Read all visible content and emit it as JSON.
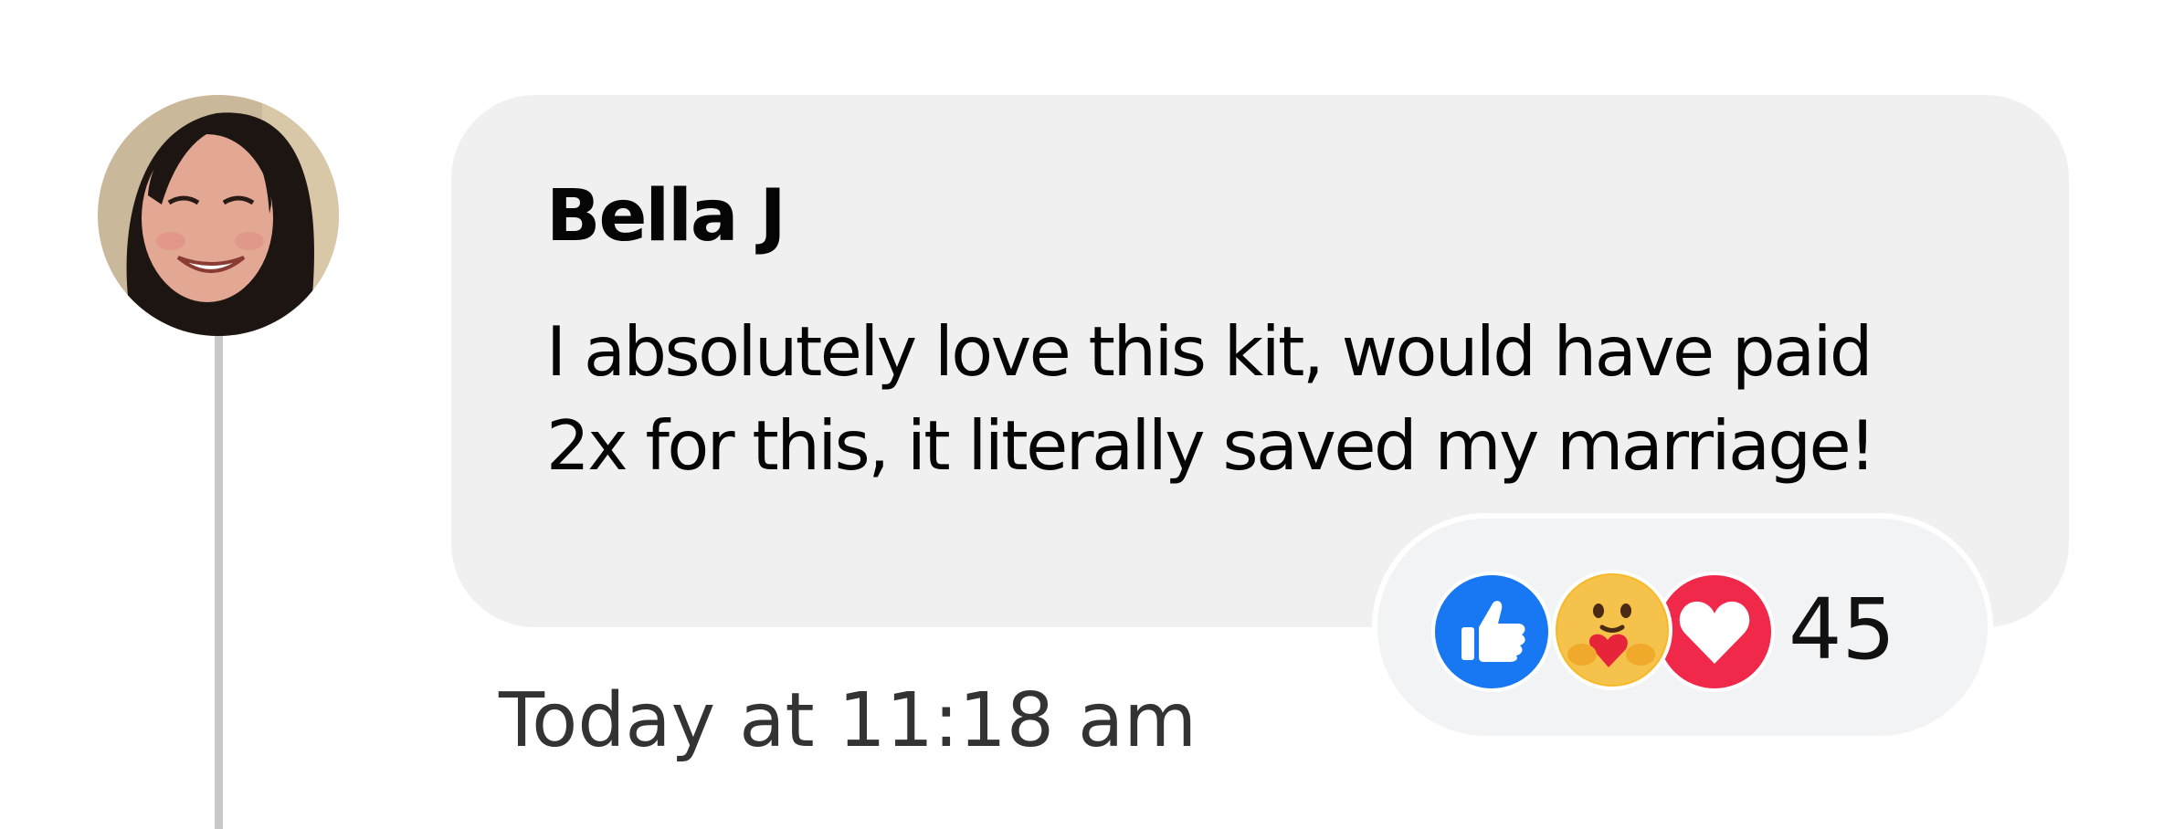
{
  "comment": {
    "author": "Bella J",
    "text_lines": [
      "I absolutely love this kit, would have paid",
      "2x for this, it literally saved my marriage!"
    ],
    "timestamp": "Today at 11:18 am"
  },
  "reactions": {
    "icons": [
      "like-icon",
      "care-icon",
      "love-icon"
    ],
    "count": "45"
  },
  "colors": {
    "bubble": "#f0f0f0",
    "like": "#1877f2",
    "love": "#f0284a",
    "care": "#f7b928",
    "thread_line": "#c8c8c8"
  }
}
